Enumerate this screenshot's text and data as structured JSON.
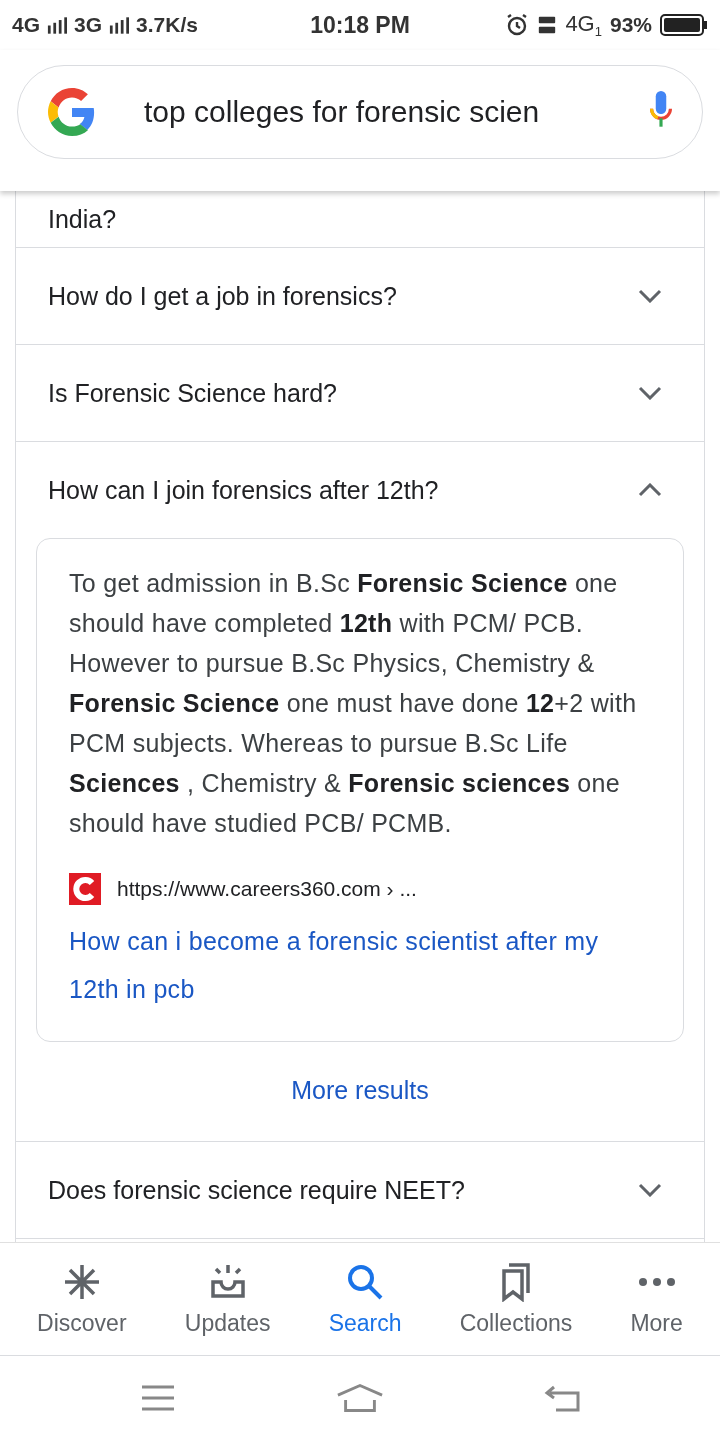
{
  "status_bar": {
    "network_1": "4G",
    "network_2": "3G",
    "speed": "3.7K/s",
    "time": "10:18 PM",
    "data_type": "4G",
    "sim": "1",
    "battery": "93%"
  },
  "search": {
    "value": "top colleges for forensic scien"
  },
  "partial_question": "India?",
  "questions": [
    {
      "text": "How do I get a job in forensics?",
      "expanded": false
    },
    {
      "text": "Is Forensic Science hard?",
      "expanded": false
    },
    {
      "text": "How can I join forensics after 12th?",
      "expanded": true,
      "answer": {
        "text": "To get admission in B.Sc **Forensic Science** one should have completed **12th** with PCM/ PCB. However to pursue B.Sc Physics, Chemistry & **Forensic Science** one must have done **12**+2 with PCM subjects. Whereas to pursue B.Sc Life **Sciences** , Chemistry & **Forensic sciences** one should have studied PCB/ PCMB.",
        "source_url": "https://www.careers360.com › ...",
        "link": "How can i become a forensic scientist after my 12th in pcb"
      },
      "more_results": "More results"
    },
    {
      "text": "Does forensic science require NEET?",
      "expanded": false
    }
  ],
  "bottom_nav": [
    {
      "label": "Discover",
      "kind": "discover",
      "selected": false
    },
    {
      "label": "Updates",
      "kind": "updates",
      "selected": false
    },
    {
      "label": "Search",
      "kind": "search",
      "selected": true
    },
    {
      "label": "Collections",
      "kind": "collections",
      "selected": false
    },
    {
      "label": "More",
      "kind": "more",
      "selected": false
    }
  ]
}
